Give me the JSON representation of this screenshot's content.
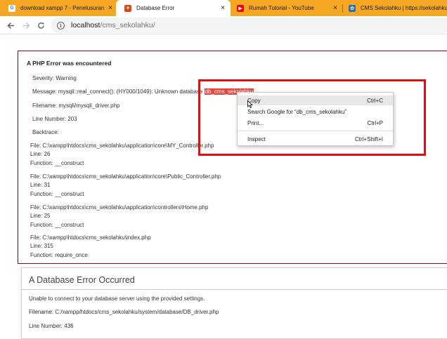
{
  "tabs": [
    {
      "title": "download xampp 7 - Penelusuran",
      "icon": "google-icon",
      "active": false
    },
    {
      "title": "Database Error",
      "icon": "codeigniter-icon",
      "active": true
    },
    {
      "title": "Rumah Tutorial - YouTube",
      "icon": "youtube-icon",
      "active": false
    },
    {
      "title": "CMS Sekolahku | https://sekolahku",
      "icon": "cms-sekolahku-icon",
      "active": false
    }
  ],
  "tab_close_glyph": "×",
  "toolbar": {
    "url_host": "localhost",
    "url_path": "/cms_sekolahku/"
  },
  "php_error": {
    "heading": "A PHP Error was encountered",
    "severity": "Severity: Warning",
    "message_prefix": "Message: mysqli::real_connect(): (HY000/1049): Unknown database ",
    "message_selected": "db_cms_sekolahku",
    "filename": "Filename: mysqli/mysqli_driver.php",
    "line_number": "Line Number: 203",
    "backtrace": "Backtrace:",
    "frames": [
      {
        "file": "File: C:\\xampp\\htdocs\\cms_sekolahku\\application\\core\\MY_Controller.php",
        "line": "Line: 26",
        "function": "Function: __construct"
      },
      {
        "file": "File: C:\\xampp\\htdocs\\cms_sekolahku\\application\\core\\Public_Controller.php",
        "line": "Line: 31",
        "function": "Function: __construct"
      },
      {
        "file": "File: C:\\xampp\\htdocs\\cms_sekolahku\\application\\controllers\\Home.php",
        "line": "Line: 25",
        "function": "Function: __construct"
      },
      {
        "file": "File: C:\\xampp\\htdocs\\cms_sekolahku\\index.php",
        "line": "Line: 315",
        "function": "Function: require_once"
      }
    ]
  },
  "db_error": {
    "heading": "A Database Error Occurred",
    "message": "Unable to connect to your database server using the provided settings.",
    "filename": "Filename: C:/xampp/htdocs/cms_sekolahku/system/database/DB_driver.php",
    "line_number": "Line Number: 436"
  },
  "context_menu": {
    "items": [
      {
        "label": "Copy",
        "shortcut": "Ctrl+C",
        "hovered": true
      },
      {
        "label": "Search Google for “db_cms_sekolahku”",
        "shortcut": ""
      },
      {
        "label": "Print...",
        "shortcut": "Ctrl+P"
      },
      {
        "label": "Inspect",
        "shortcut": "Ctrl+Shift+I"
      }
    ]
  },
  "colors": {
    "tab_strip": "#f5a623",
    "selection": "#e8453c",
    "annotation_border": "#e01010",
    "php_error_border": "#990000"
  }
}
